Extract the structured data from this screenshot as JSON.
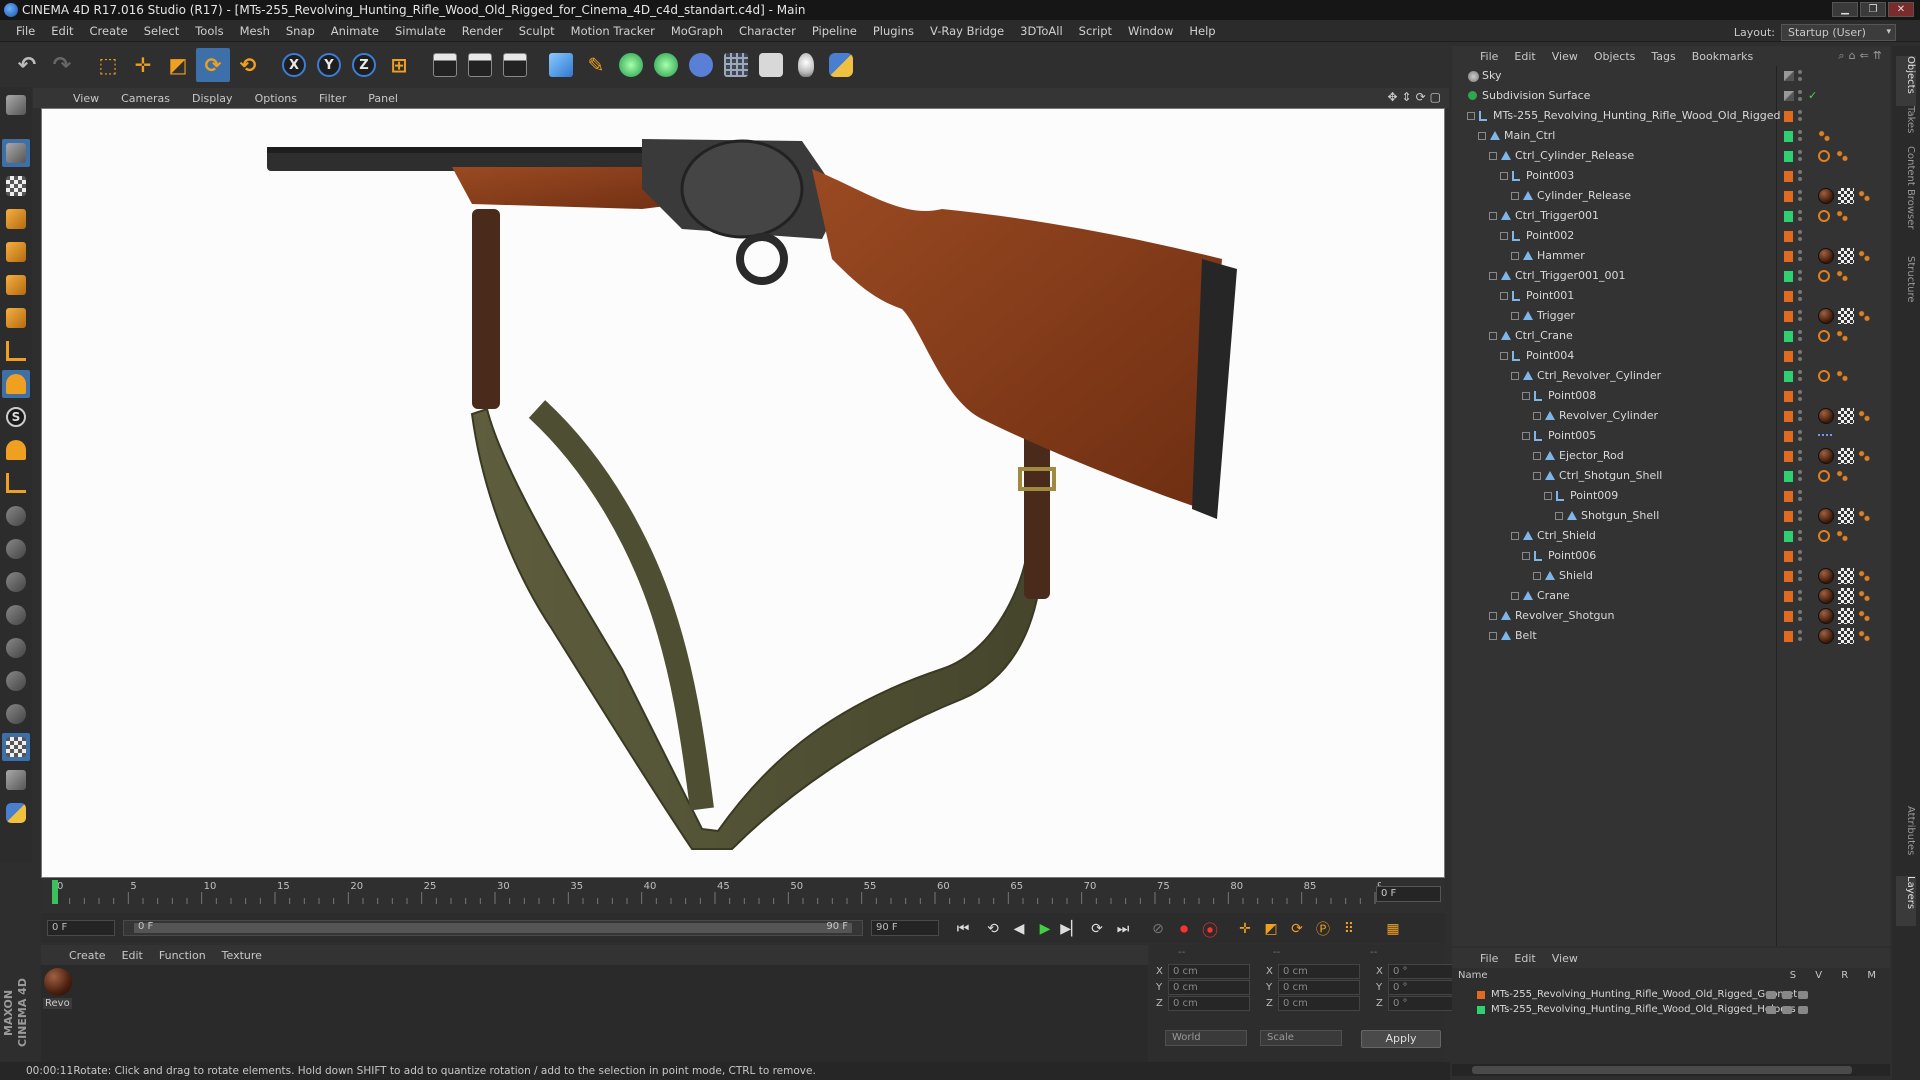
{
  "window": {
    "title": "CINEMA 4D R17.016 Studio (R17) - [MTs-255_Revolving_Hunting_Rifle_Wood_Old_Rigged_for_Cinema_4D_c4d_standart.c4d] - Main"
  },
  "menubar": {
    "items": [
      "File",
      "Edit",
      "Create",
      "Select",
      "Tools",
      "Mesh",
      "Snap",
      "Animate",
      "Simulate",
      "Render",
      "Sculpt",
      "Motion Tracker",
      "MoGraph",
      "Character",
      "Pipeline",
      "Plugins",
      "V-Ray Bridge",
      "3DToAll",
      "Script",
      "Window",
      "Help"
    ],
    "layout_label": "Layout:",
    "layout_value": "Startup (User)"
  },
  "toolbar": {
    "axis_x": "X",
    "axis_y": "Y",
    "axis_z": "Z"
  },
  "lefttools": {
    "s_label": "S"
  },
  "viewport": {
    "menu": [
      "View",
      "Cameras",
      "Display",
      "Options",
      "Filter",
      "Panel"
    ]
  },
  "timeline": {
    "ticks": [
      0,
      5,
      10,
      15,
      20,
      25,
      30,
      35,
      40,
      45,
      50,
      55,
      60,
      65,
      70,
      75,
      80,
      85,
      90
    ],
    "current_frame": "0 F"
  },
  "playback": {
    "start_frame": "0 F",
    "range_start": "0 F",
    "range_end": "90 F",
    "end_frame": "90 F"
  },
  "material_manager": {
    "menu": [
      "Create",
      "Edit",
      "Function",
      "Texture"
    ],
    "materials": [
      {
        "name": "Revo"
      }
    ]
  },
  "coordinates": {
    "header": [
      "--",
      "--",
      "--"
    ],
    "rows": [
      {
        "a1": "X",
        "v1": "0 cm",
        "a2": "X",
        "v2": "0 cm",
        "a3": "X",
        "v3": "0 °"
      },
      {
        "a1": "Y",
        "v1": "0 cm",
        "a2": "Y",
        "v2": "0 cm",
        "a3": "Y",
        "v3": "0 °"
      },
      {
        "a1": "Z",
        "v1": "0 cm",
        "a2": "Z",
        "v2": "0 cm",
        "a3": "Z",
        "v3": "0 °"
      }
    ],
    "mode_world": "World",
    "mode_scale": "Scale",
    "apply_label": "Apply"
  },
  "statusbar": {
    "time": "00:00:11",
    "message": "Rotate: Click and drag to rotate elements. Hold down SHIFT to add to quantize rotation / add to the selection in point mode, CTRL to remove."
  },
  "branding": {
    "maxon": "MAXON CINEMA 4D"
  },
  "object_manager": {
    "menu": [
      "File",
      "Edit",
      "View",
      "Objects",
      "Tags",
      "Bookmarks"
    ],
    "objects": [
      {
        "name": "Sky",
        "depth": 0,
        "icon": "sky",
        "layer": "none",
        "tags": []
      },
      {
        "name": "Subdivision Surface",
        "depth": 0,
        "icon": "subd",
        "layer": "none",
        "tags": [],
        "check": "✓"
      },
      {
        "name": "MTs-255_Revolving_Hunting_Rifle_Wood_Old_Rigged",
        "depth": 1,
        "icon": "null",
        "layer": "orange",
        "tags": []
      },
      {
        "name": "Main_Ctrl",
        "depth": 2,
        "icon": "joint",
        "layer": "green",
        "tags": [
          "dots"
        ]
      },
      {
        "name": "Ctrl_Cylinder_Release",
        "depth": 3,
        "icon": "joint",
        "layer": "green",
        "tags": [
          "ik",
          "dots"
        ]
      },
      {
        "name": "Point003",
        "depth": 4,
        "icon": "null",
        "layer": "orange",
        "tags": []
      },
      {
        "name": "Cylinder_Release",
        "depth": 5,
        "icon": "joint",
        "layer": "orange",
        "tags": [
          "mat",
          "uvw",
          "dots"
        ]
      },
      {
        "name": "Ctrl_Trigger001",
        "depth": 3,
        "icon": "joint",
        "layer": "green",
        "tags": [
          "ik",
          "dots"
        ]
      },
      {
        "name": "Point002",
        "depth": 4,
        "icon": "null",
        "layer": "orange",
        "tags": []
      },
      {
        "name": "Hammer",
        "depth": 5,
        "icon": "joint",
        "layer": "orange",
        "tags": [
          "mat",
          "uvw",
          "dots"
        ]
      },
      {
        "name": "Ctrl_Trigger001_001",
        "depth": 3,
        "icon": "joint",
        "layer": "green",
        "tags": [
          "ik",
          "dots"
        ]
      },
      {
        "name": "Point001",
        "depth": 4,
        "icon": "null",
        "layer": "orange",
        "tags": []
      },
      {
        "name": "Trigger",
        "depth": 5,
        "icon": "joint",
        "layer": "orange",
        "tags": [
          "mat",
          "uvw",
          "dots"
        ]
      },
      {
        "name": "Ctrl_Crane",
        "depth": 3,
        "icon": "joint",
        "layer": "green",
        "tags": [
          "ik",
          "dots"
        ]
      },
      {
        "name": "Point004",
        "depth": 4,
        "icon": "null",
        "layer": "orange",
        "tags": []
      },
      {
        "name": "Ctrl_Revolver_Cylinder",
        "depth": 5,
        "icon": "joint",
        "layer": "green",
        "tags": [
          "ik",
          "dots"
        ]
      },
      {
        "name": "Point008",
        "depth": 6,
        "icon": "null",
        "layer": "orange",
        "tags": []
      },
      {
        "name": "Revolver_Cylinder",
        "depth": 7,
        "icon": "joint",
        "layer": "orange",
        "tags": [
          "mat",
          "uvw",
          "dots"
        ]
      },
      {
        "name": "Point005",
        "depth": 6,
        "icon": "null",
        "layer": "orange",
        "tags": [
          "blue"
        ]
      },
      {
        "name": "Ejector_Rod",
        "depth": 7,
        "icon": "joint",
        "layer": "orange",
        "tags": [
          "mat",
          "uvw",
          "dots"
        ]
      },
      {
        "name": "Ctrl_Shotgun_Shell",
        "depth": 7,
        "icon": "joint",
        "layer": "green",
        "tags": [
          "ik",
          "dots"
        ]
      },
      {
        "name": "Point009",
        "depth": 8,
        "icon": "null",
        "layer": "orange",
        "tags": []
      },
      {
        "name": "Shotgun_Shell",
        "depth": 9,
        "icon": "joint",
        "layer": "orange",
        "tags": [
          "mat",
          "uvw",
          "dots"
        ]
      },
      {
        "name": "Ctrl_Shield",
        "depth": 5,
        "icon": "joint",
        "layer": "green",
        "tags": [
          "ik",
          "dots"
        ]
      },
      {
        "name": "Point006",
        "depth": 6,
        "icon": "null",
        "layer": "orange",
        "tags": []
      },
      {
        "name": "Shield",
        "depth": 7,
        "icon": "joint",
        "layer": "orange",
        "tags": [
          "mat",
          "uvw",
          "dots"
        ]
      },
      {
        "name": "Crane",
        "depth": 5,
        "icon": "joint",
        "layer": "orange",
        "tags": [
          "mat",
          "uvw",
          "dots"
        ]
      },
      {
        "name": "Revolver_Shotgun",
        "depth": 3,
        "icon": "joint",
        "layer": "orange",
        "tags": [
          "mat",
          "uvw",
          "dots"
        ]
      },
      {
        "name": "Belt",
        "depth": 3,
        "icon": "joint",
        "layer": "orange",
        "tags": [
          "mat",
          "uvw",
          "dots"
        ]
      }
    ]
  },
  "layer_manager": {
    "menu": [
      "File",
      "Edit",
      "View"
    ],
    "header_name": "Name",
    "header_cols": "S V R M",
    "layers": [
      {
        "name": "MTs-255_Revolving_Hunting_Rifle_Wood_Old_Rigged_Geometry",
        "color": "#e06a20"
      },
      {
        "name": "MTs-255_Revolving_Hunting_Rifle_Wood_Old_Rigged_Helpers",
        "color": "#2fd070"
      }
    ]
  },
  "side_tabs": [
    "Objects",
    "Takes",
    "Content Browser",
    "Structure",
    "Attributes",
    "Layers"
  ],
  "colors": {
    "accent_orange": "#f0a020",
    "layer_orange": "#e06a20",
    "layer_green": "#2fd070",
    "wood": "#8b3f1c",
    "strap": "#5a5a3a",
    "metal": "#3a3a3a"
  }
}
